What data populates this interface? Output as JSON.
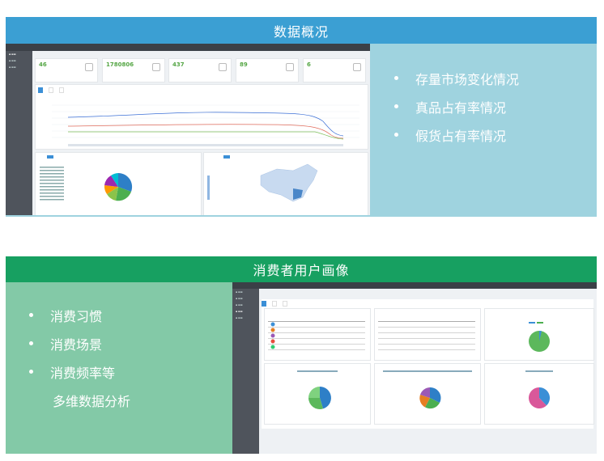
{
  "section1": {
    "title": "数据概况",
    "bullets": [
      "存量市场变化情况",
      "真品占有率情况",
      "假货占有率情况"
    ],
    "stats": [
      {
        "value": "46"
      },
      {
        "value": "1780806"
      },
      {
        "value": "437"
      },
      {
        "value": "89"
      },
      {
        "value": "6"
      }
    ]
  },
  "section2": {
    "title": "消费者用户画像",
    "bullets": [
      "消费习惯",
      "消费场景",
      "消费频率等"
    ],
    "bullet_continuation": "多维数据分析"
  },
  "colors": {
    "band1": "#3b9fd3",
    "band2": "#17a061",
    "panel1": "#9fd3df",
    "panel2": "#83c9a7",
    "stat_green": "#55a645"
  }
}
